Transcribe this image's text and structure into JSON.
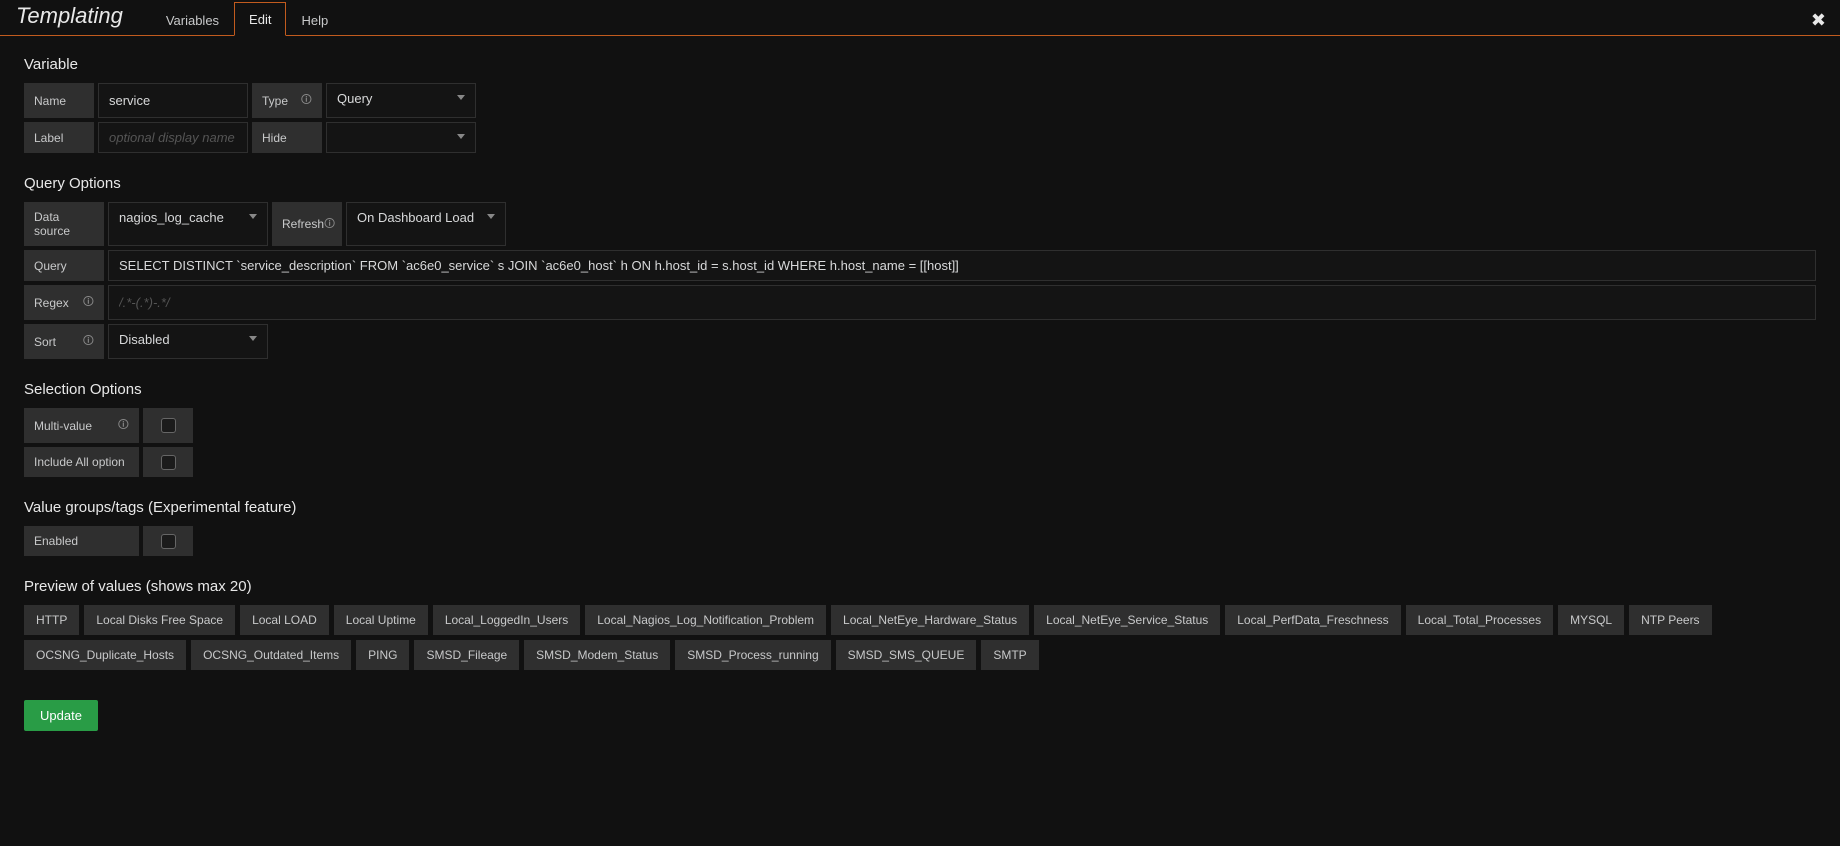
{
  "header": {
    "title": "Templating",
    "tabs": [
      "Variables",
      "Edit",
      "Help"
    ],
    "active_tab": "Edit",
    "close_icon": "✖"
  },
  "variable": {
    "section": "Variable",
    "name_label": "Name",
    "name_value": "service",
    "type_label": "Type",
    "type_value": "Query",
    "label_label": "Label",
    "label_placeholder": "optional display name",
    "hide_label": "Hide",
    "hide_value": ""
  },
  "query_options": {
    "section": "Query Options",
    "ds_label": "Data source",
    "ds_value": "nagios_log_cache",
    "refresh_label": "Refresh",
    "refresh_value": "On Dashboard Load",
    "query_label": "Query",
    "query_value": "SELECT DISTINCT `service_description` FROM `ac6e0_service` s JOIN `ac6e0_host` h ON h.host_id = s.host_id WHERE h.host_name = [[host]]",
    "regex_label": "Regex",
    "regex_placeholder": "/.*-(.*)-.*/",
    "sort_label": "Sort",
    "sort_value": "Disabled"
  },
  "selection": {
    "section": "Selection Options",
    "multi_label": "Multi-value",
    "include_all_label": "Include All option"
  },
  "value_groups": {
    "section": "Value groups/tags (Experimental feature)",
    "enabled_label": "Enabled"
  },
  "preview": {
    "section": "Preview of values (shows max 20)",
    "values": [
      "HTTP",
      "Local Disks Free Space",
      "Local LOAD",
      "Local Uptime",
      "Local_LoggedIn_Users",
      "Local_Nagios_Log_Notification_Problem",
      "Local_NetEye_Hardware_Status",
      "Local_NetEye_Service_Status",
      "Local_PerfData_Freschness",
      "Local_Total_Processes",
      "MYSQL",
      "NTP Peers",
      "OCSNG_Duplicate_Hosts",
      "OCSNG_Outdated_Items",
      "PING",
      "SMSD_Fileage",
      "SMSD_Modem_Status",
      "SMSD_Process_running",
      "SMSD_SMS_QUEUE",
      "SMTP"
    ]
  },
  "buttons": {
    "update": "Update"
  },
  "info_glyph": "🛈"
}
